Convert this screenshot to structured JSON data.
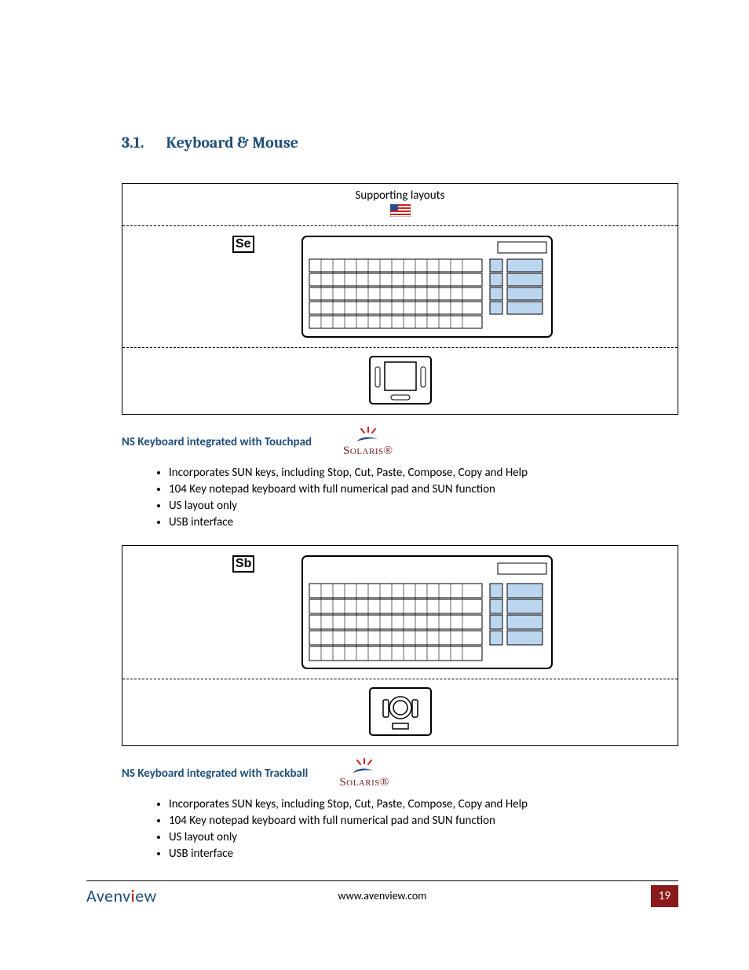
{
  "heading": {
    "number": "3.1.",
    "title": "Keyboard & Mouse"
  },
  "supporting_label": "Supporting layouts",
  "products": [
    {
      "code": "Se",
      "sub": "NS Keyboard integrated with Touchpad",
      "logo": "Solaris®",
      "bullets": [
        "Incorporates SUN keys, including Stop, Cut, Paste, Compose, Copy and Help",
        "104 Key notepad keyboard with full numerical pad and SUN function",
        "US layout only",
        "USB interface"
      ]
    },
    {
      "code": "Sb",
      "sub": "NS Keyboard integrated with Trackball",
      "logo": "Solaris®",
      "bullets": [
        "Incorporates SUN keys, including Stop, Cut, Paste, Compose, Copy and Help",
        "104 Key notepad keyboard with full numerical pad and SUN function",
        "US layout only",
        "USB interface"
      ]
    }
  ],
  "footer": {
    "brand_a": "Avenv",
    "brand_b": "ew",
    "url": "www.avenview.com",
    "page": "19"
  }
}
